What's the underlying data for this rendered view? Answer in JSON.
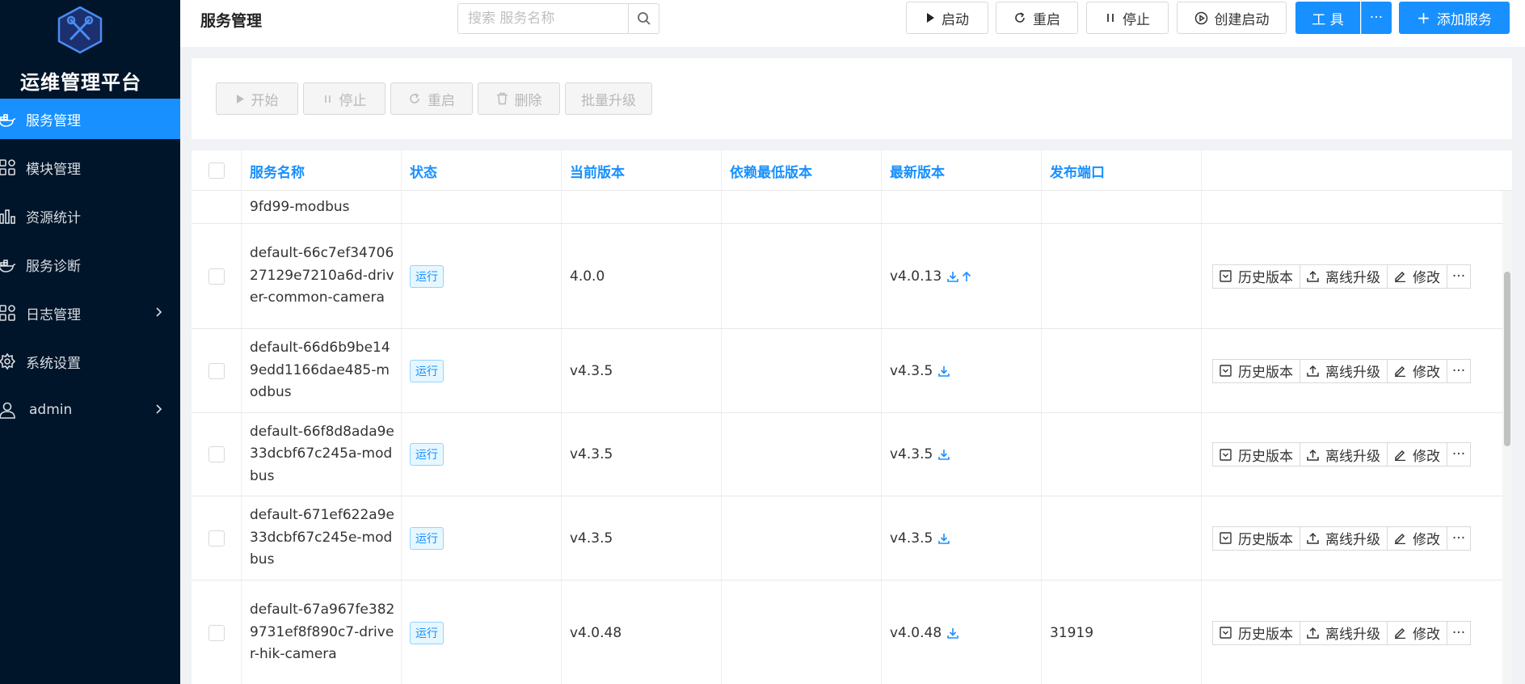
{
  "sidebar": {
    "app_title": "运维管理平台",
    "logo_icon": "tools-hexagon-icon",
    "items": [
      {
        "label": "服务管理",
        "icon": "docker-icon",
        "active": true
      },
      {
        "label": "模块管理",
        "icon": "grid-icon",
        "active": false
      },
      {
        "label": "资源统计",
        "icon": "bar-chart-icon",
        "active": false
      },
      {
        "label": "服务诊断",
        "icon": "docker-icon",
        "active": false
      },
      {
        "label": "日志管理",
        "icon": "grid-icon",
        "active": false,
        "has_submenu": true
      },
      {
        "label": "系统设置",
        "icon": "gear-icon",
        "active": false
      },
      {
        "label": "admin",
        "icon": "user-icon",
        "active": false,
        "has_submenu": true
      }
    ]
  },
  "header": {
    "title": "服务管理",
    "search_placeholder": "搜索 服务名称",
    "buttons": {
      "start": "启动",
      "restart": "重启",
      "stop": "停止",
      "create_start": "创建启动",
      "tools": "工 具",
      "more": "···",
      "add_service": "添加服务"
    }
  },
  "toolbar": {
    "start": "开始",
    "stop": "停止",
    "restart": "重启",
    "delete": "删除",
    "batch_upgrade": "批量升级"
  },
  "table": {
    "columns": [
      "服务名称",
      "状态",
      "当前版本",
      "依赖最低版本",
      "最新版本",
      "发布端口"
    ],
    "partial_row_name": "9fd99-modbus",
    "rows": [
      {
        "name": "default-66c7ef3470627129e7210a6d-driver-common-camera",
        "status": "运行",
        "current_version": "4.0.0",
        "min_dep_version": "",
        "latest_version": "v4.0.13",
        "has_upgrade": true,
        "port": ""
      },
      {
        "name": "default-66d6b9be149edd1166dae485-modbus",
        "status": "运行",
        "current_version": "v4.3.5",
        "min_dep_version": "",
        "latest_version": "v4.3.5",
        "has_upgrade": false,
        "port": ""
      },
      {
        "name": "default-66f8d8ada9e33dcbf67c245a-modbus",
        "status": "运行",
        "current_version": "v4.3.5",
        "min_dep_version": "",
        "latest_version": "v4.3.5",
        "has_upgrade": false,
        "port": ""
      },
      {
        "name": "default-671ef622a9e33dcbf67c245e-modbus",
        "status": "运行",
        "current_version": "v4.3.5",
        "min_dep_version": "",
        "latest_version": "v4.3.5",
        "has_upgrade": false,
        "port": ""
      },
      {
        "name": "default-67a967fe3829731ef8f890c7-driver-hik-camera",
        "status": "运行",
        "current_version": "v4.0.48",
        "min_dep_version": "",
        "latest_version": "v4.0.48",
        "has_upgrade": false,
        "port": "31919"
      }
    ],
    "row_actions": {
      "history": "历史版本",
      "offline_upgrade": "离线升级",
      "edit": "修改",
      "more": "···"
    }
  },
  "colors": {
    "sidebar_bg": "#001529",
    "primary": "#1890ff",
    "tag_bg": "#e6f7ff",
    "tag_border": "#91d5ff"
  }
}
